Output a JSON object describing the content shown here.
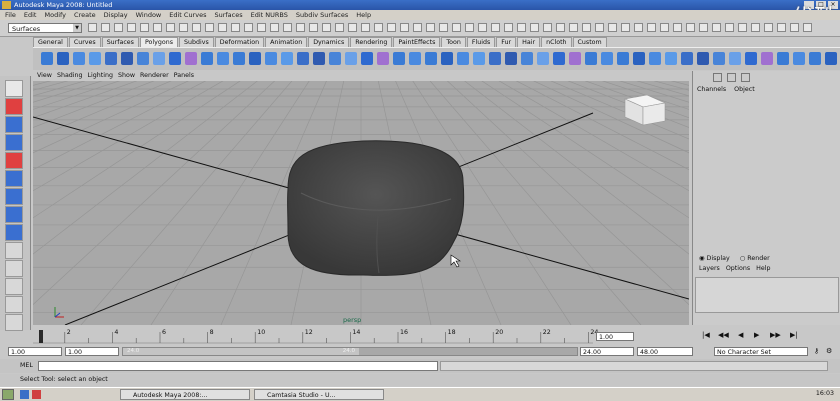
{
  "window": {
    "title": "Autodesk Maya 2008:  Untitled",
    "controls": [
      "_",
      "□",
      "×"
    ]
  },
  "watermark": "优酷",
  "menubar": [
    "File",
    "Edit",
    "Modify",
    "Create",
    "Display",
    "Window",
    "Edit Curves",
    "Surfaces",
    "Edit NURBS",
    "Subdiv Surfaces",
    "Help"
  ],
  "status_line": {
    "mode": "Surfaces"
  },
  "shelf_tabs": [
    "General",
    "Curves",
    "Surfaces",
    "Polygons",
    "Subdivs",
    "Deformation",
    "Animation",
    "Dynamics",
    "Rendering",
    "PaintEffects",
    "Toon",
    "Fluids",
    "Fur",
    "Hair",
    "nCloth",
    "Custom"
  ],
  "shelf_active": "Polygons",
  "panel_menu": [
    "View",
    "Shading",
    "Lighting",
    "Show",
    "Renderer",
    "Panels"
  ],
  "viewport": {
    "camera_label": "persp"
  },
  "channel_box": {
    "menu": [
      "Channels",
      "Object"
    ]
  },
  "layer_editor": {
    "options": [
      "Display",
      "Render"
    ],
    "selected": "Display",
    "menu": [
      "Layers",
      "Options",
      "Help"
    ]
  },
  "time_slider": {
    "ticks": [
      "2",
      "4",
      "6",
      "8",
      "10",
      "12",
      "14",
      "16",
      "18",
      "20",
      "22",
      "24"
    ],
    "current_frame": "1.00"
  },
  "range_slider": {
    "start": "1.00",
    "start_playback": "1.00",
    "end_playback": "24.00",
    "end": "48.00",
    "character_set": "No Character Set",
    "range_left": "24.0",
    "range_right": "24.0"
  },
  "command_line": {
    "label": "MEL"
  },
  "help_line": "Select Tool: select an object",
  "taskbar": {
    "items": [
      "Autodesk Maya 2008:...",
      "Camtasia Studio - U..."
    ],
    "clock": "16:03"
  },
  "colors": {
    "viewport_bg": "#a8a8a8",
    "grid": "#8e8e8e",
    "object": "#4a4a4a"
  }
}
